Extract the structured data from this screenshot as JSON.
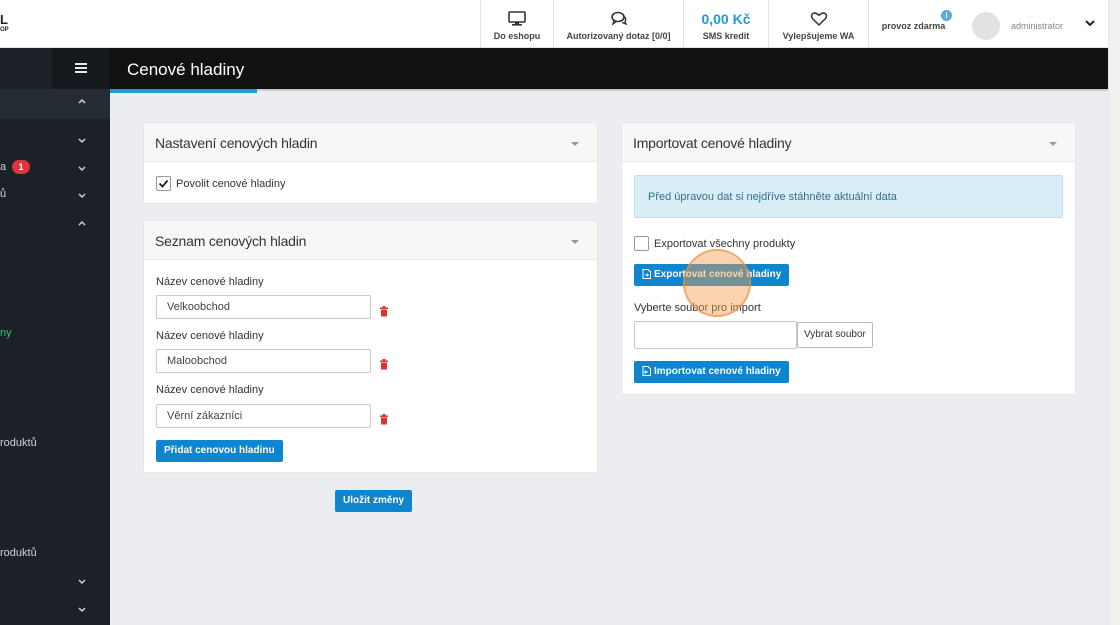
{
  "header": {
    "logo_main": "L",
    "logo_sub": "OP",
    "eshop_label": "Do eshopu",
    "query_label": "Autorizovaný dotaz [0/0]",
    "credit_value": "0,00 Kč",
    "credit_label": "SMS kredit",
    "improve_label": "Vylepšujeme WA",
    "plan_label": "provoz zdarma",
    "info_glyph": "i",
    "user_name": "administrator"
  },
  "sidebar": {
    "badge": "1",
    "items": [
      {
        "label": "a"
      },
      {
        "label": "ů"
      },
      {
        "label": "ny"
      },
      {
        "label": "roduktů"
      },
      {
        "label": "roduktů"
      }
    ]
  },
  "page": {
    "title": "Cenové hladiny"
  },
  "settings_panel": {
    "title": "Nastavení cenových hladin",
    "enable_label": "Povolit cenové hladiny",
    "enable_checked": true
  },
  "levels_panel": {
    "title": "Seznam cenových hladin",
    "field_label": "Název cenové hladiny",
    "levels": [
      "Velkoobchod",
      "Maloobchod",
      "Věrní zákazníci"
    ],
    "add_button": "Přidat cenovou hladinu"
  },
  "save_button": "Uložit změny",
  "import_panel": {
    "title": "Importovat cenové hladiny",
    "alert": "Před úpravou dat si nejdříve stáhněte aktuální data",
    "export_all_label": "Exportovat všechny produkty",
    "export_button": "Exportovat cenové hladiny",
    "file_label": "Vyberte soubor pro import",
    "file_value": "",
    "choose_file_button": "Vybrat soubor",
    "import_button": "Importovat cenové hladiny"
  },
  "colors": {
    "primary": "#0d86cf",
    "sidebar": "#1c2127",
    "badge": "#d9363e",
    "active_text": "#3ac47d",
    "credit": "#1e9ad6"
  }
}
